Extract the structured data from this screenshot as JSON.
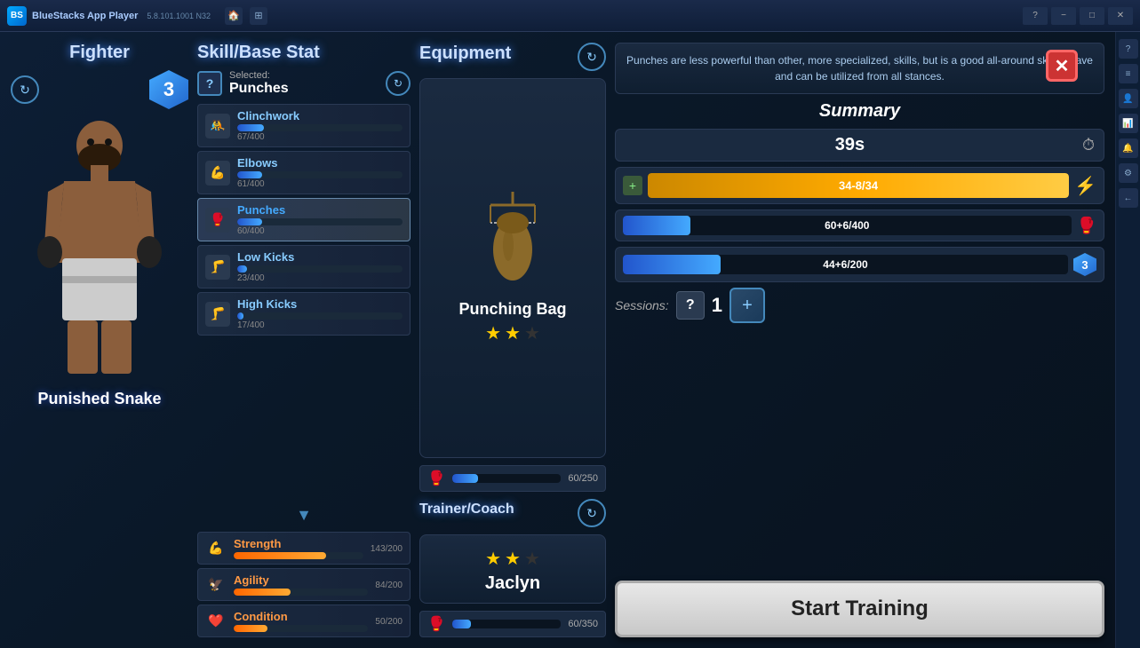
{
  "titleBar": {
    "appName": "BlueStacks App Player",
    "version": "5.8.101.1001 N32",
    "homeIcon": "🏠",
    "multiIcon": "⊞",
    "helpIcon": "?",
    "minimizeLabel": "−",
    "maximizeLabel": "□",
    "closeLabel": "✕"
  },
  "fighter": {
    "panelTitle": "Fighter",
    "level": "3",
    "name": "Punished Snake"
  },
  "skillStat": {
    "panelTitle": "Skill/Base Stat",
    "selectedLabel": "Selected:",
    "selectedSkill": "Punches",
    "skills": [
      {
        "name": "Clinchwork",
        "current": 67,
        "max": 400,
        "pct": 16
      },
      {
        "name": "Elbows",
        "current": 61,
        "max": 400,
        "pct": 15
      },
      {
        "name": "Punches",
        "current": 60,
        "max": 400,
        "pct": 15,
        "selected": true
      },
      {
        "name": "Low Kicks",
        "current": 23,
        "max": 400,
        "pct": 6
      },
      {
        "name": "High Kicks",
        "current": 17,
        "max": 400,
        "pct": 4
      }
    ],
    "scrollIndicator": "▼",
    "baseStats": [
      {
        "name": "Strength",
        "current": 143,
        "max": 200,
        "pct": 71
      },
      {
        "name": "Agility",
        "current": 84,
        "max": 200,
        "pct": 42
      },
      {
        "name": "Condition",
        "current": 50,
        "max": 200,
        "pct": 25
      }
    ]
  },
  "equipment": {
    "panelTitle": "Equipment",
    "item": {
      "name": "Punching Bag",
      "stars": 2,
      "maxStars": 3
    },
    "itemBar": {
      "current": 60,
      "max": 250,
      "pct": 24
    },
    "trainerSection": {
      "title": "Trainer/Coach",
      "trainer": {
        "name": "Jaclyn",
        "stars": 2,
        "maxStars": 3
      },
      "trainerBar": {
        "current": 60,
        "max": 350,
        "pct": 17
      }
    }
  },
  "summary": {
    "infoText": "Punches are less powerful than other, more specialized, skills, but is a good all-around skill to have and can be utilized from all stances.",
    "title": "Summary",
    "time": "39s",
    "energy": {
      "current": "34",
      "bonus": "-8",
      "max": "34",
      "display": "34-8/34",
      "pct": 100
    },
    "punch": {
      "display": "60+6/400",
      "pct": 15
    },
    "cond": {
      "display": "44+6/200",
      "pct": 22
    },
    "sessions": {
      "label": "Sessions:",
      "count": "1"
    },
    "closeLabel": "✕",
    "startButton": "Start Training"
  },
  "rightSidebar": {
    "icons": [
      "?",
      "📋",
      "👤",
      "📊",
      "🔔",
      "⚙",
      "←"
    ]
  }
}
